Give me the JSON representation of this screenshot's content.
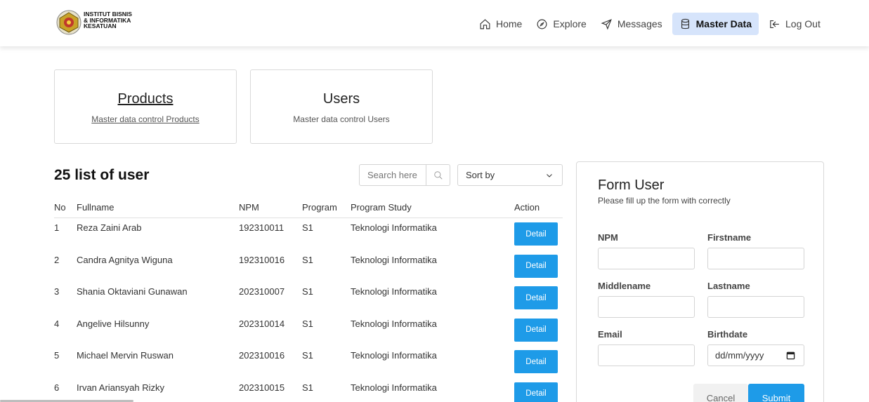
{
  "brand": {
    "line1": "INSTITUT BISNIS",
    "line2": "& INFORMATIKA",
    "line3": "KESATUAN"
  },
  "nav": {
    "home": "Home",
    "explore": "Explore",
    "messages": "Messages",
    "master_data": "Master Data",
    "logout": "Log Out"
  },
  "cards": {
    "products": {
      "title": "Products",
      "subtitle": "Master data control Products"
    },
    "users": {
      "title": "Users",
      "subtitle": "Master data control Users"
    }
  },
  "list": {
    "title": "25 list of user",
    "search_placeholder": "Search here",
    "sort_label": "Sort by",
    "headers": {
      "no": "No",
      "fullname": "Fullname",
      "npm": "NPM",
      "program": "Program",
      "study": "Program Study",
      "action": "Action"
    },
    "detail_label": "Detail",
    "rows": [
      {
        "no": "1",
        "fullname": "Reza Zaini Arab",
        "npm": "192310011",
        "program": "S1",
        "study": "Teknologi Informatika"
      },
      {
        "no": "2",
        "fullname": "Candra Agnitya Wiguna",
        "npm": "192310016",
        "program": "S1",
        "study": "Teknologi Informatika"
      },
      {
        "no": "3",
        "fullname": "Shania Oktaviani Gunawan",
        "npm": "202310007",
        "program": "S1",
        "study": "Teknologi Informatika"
      },
      {
        "no": "4",
        "fullname": "Angelive Hilsunny",
        "npm": "202310014",
        "program": "S1",
        "study": "Teknologi Informatika"
      },
      {
        "no": "5",
        "fullname": "Michael Mervin Ruswan",
        "npm": "202310016",
        "program": "S1",
        "study": "Teknologi Informatika"
      },
      {
        "no": "6",
        "fullname": "Irvan Ariansyah Rizky",
        "npm": "202310015",
        "program": "S1",
        "study": "Teknologi Informatika"
      }
    ]
  },
  "form": {
    "title": "Form User",
    "subtitle": "Please fill up the form with correctly",
    "npm_label": "NPM",
    "firstname_label": "Firstname",
    "middlename_label": "Middlename",
    "lastname_label": "Lastname",
    "email_label": "Email",
    "birthdate_label": "Birthdate",
    "birthdate_placeholder": "dd/mm/yyyy",
    "cancel_label": "Cancel",
    "submit_label": "Submit"
  },
  "colors": {
    "primary": "#1e9be8",
    "nav_active_bg": "#d6e4fb"
  }
}
